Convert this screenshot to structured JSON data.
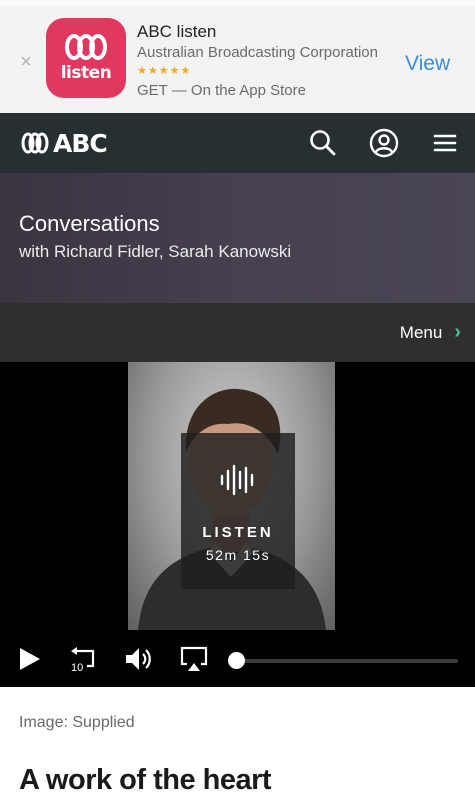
{
  "app_banner": {
    "close_glyph": "×",
    "icon_word": "listen",
    "name": "ABC listen",
    "publisher": "Australian Broadcasting Corporation",
    "stars": "★★★★★",
    "availability": "GET — On the App Store",
    "action": "View",
    "icon_color": "#e1385f"
  },
  "header": {
    "logo_text": "ABC",
    "icons": [
      "search-icon",
      "account-icon",
      "menu-icon"
    ]
  },
  "program": {
    "title": "Conversations",
    "hosts": "with Richard Fidler, Sarah Kanowski"
  },
  "menu": {
    "label": "Menu",
    "chevron": "›",
    "accent": "#3ec6a0"
  },
  "player": {
    "listen_label": "LISTEN",
    "duration": "52m 15s",
    "progress": 0,
    "controls": [
      "play-icon",
      "rewind-10-icon",
      "volume-icon",
      "airplay-icon"
    ],
    "rewind_seconds": "10"
  },
  "article": {
    "image_caption": "Image: Supplied",
    "headline": "A work of the heart"
  }
}
